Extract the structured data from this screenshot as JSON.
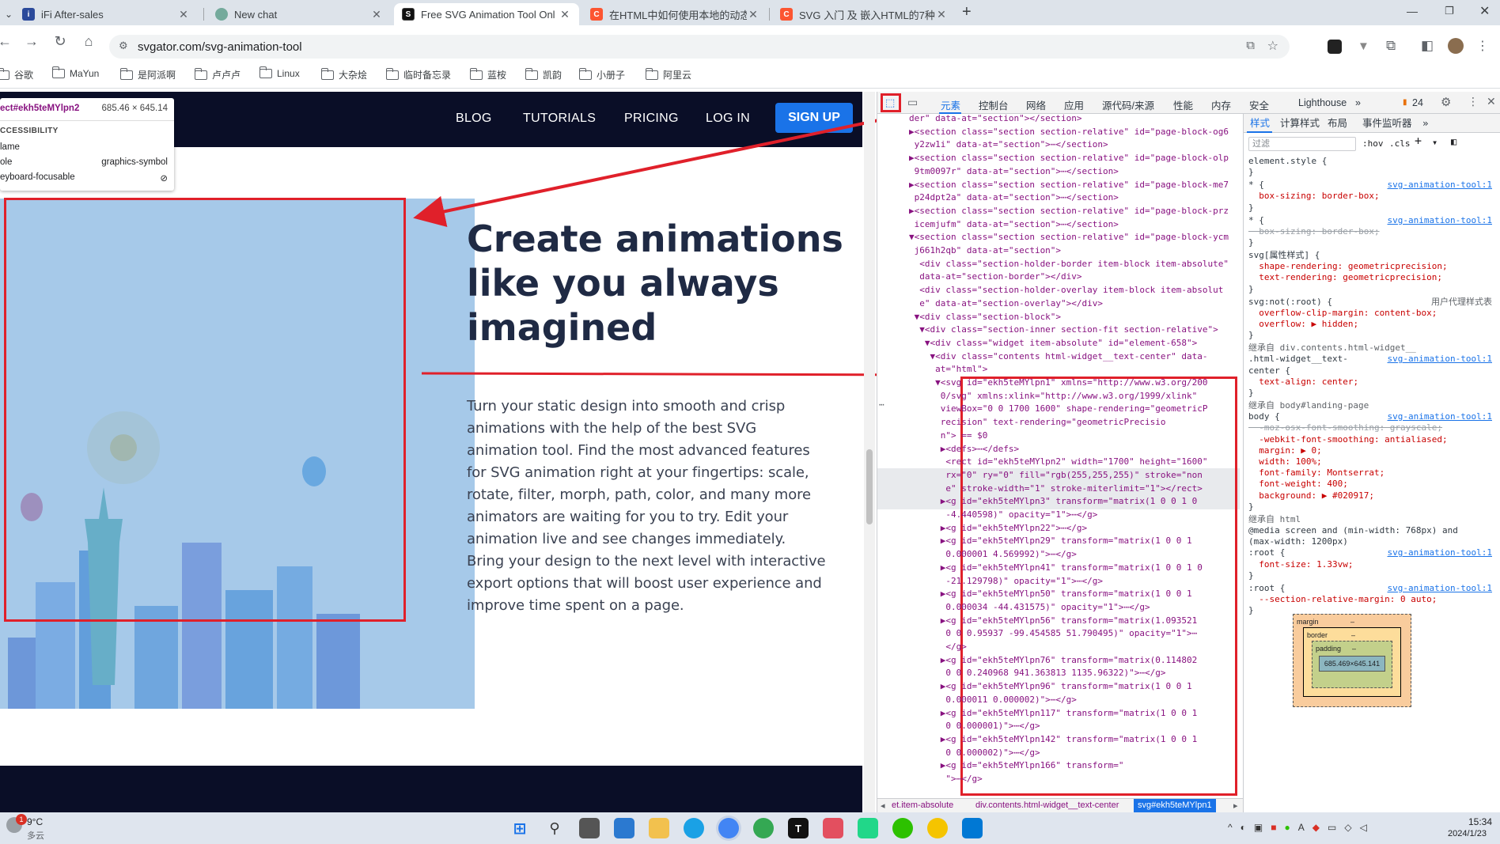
{
  "tabs": [
    {
      "title": "iFi After-sales",
      "icon": "ifi-favicon",
      "active": false
    },
    {
      "title": "New chat",
      "icon": "chatgpt-favicon",
      "active": false
    },
    {
      "title": "Free SVG Animation Tool Onl",
      "icon": "svgator-favicon",
      "active": true
    },
    {
      "title": "在HTML中如何使用本地的动态",
      "icon": "csdn-favicon",
      "active": false
    },
    {
      "title": "SVG 入门 及 嵌入HTML的7种方",
      "icon": "csdn-favicon",
      "active": false
    }
  ],
  "omnibox": {
    "url": "svgator.com/svg-animation-tool"
  },
  "bookmarks": [
    "谷歌",
    "MaYun",
    "是阿派啊",
    "卢卢卢",
    "Linux",
    "大杂烩",
    "临时备忘录",
    "蓝桉",
    "凯韵",
    "小册子",
    "阿里云"
  ],
  "site": {
    "nav": [
      "BLOG",
      "TUTORIALS",
      "PRICING",
      "LOG IN"
    ],
    "signup": "SIGN UP",
    "hero_title_lines": [
      "Create animations",
      "like you always",
      "imagined"
    ],
    "hero_body_lines": [
      "Turn your static design into smooth and crisp",
      "animations with the help of the best SVG",
      "animation tool. Find the most advanced features",
      "for SVG animation right at your fingertips: scale,",
      "rotate, filter, morph, path, color, and many more",
      "animators are waiting for you to try. Edit your",
      "animation live and see changes immediately.",
      "Bring your design to the next level with interactive",
      "export options that will boost user experience and",
      "improve time spent on a page."
    ]
  },
  "tooltip": {
    "element": "ect#ekh5teMYlpn2",
    "size": "685.46 × 645.14",
    "section": "CCESSIBILITY",
    "name_label": "lame",
    "role_label": "ole",
    "role_value": "graphics-symbol",
    "focus_label": "eyboard-focusable"
  },
  "devtools": {
    "tabs": [
      "元素",
      "控制台",
      "网络",
      "应用",
      "源代码/来源",
      "性能",
      "内存",
      "安全",
      "Lighthouse"
    ],
    "issues_count": "24",
    "style_tabs": [
      "样式",
      "计算样式",
      "布局",
      "事件监听器"
    ],
    "filter_placeholder": "过滤",
    "hov": ":hov",
    "cls": ".cls",
    "dom_lines": [
      "der\" data-at=\"section\"></section>",
      "▶<section class=\"section section-relative\" id=\"page-block-og6",
      " y2zw1i\" data-at=\"section\">⋯</section>",
      "▶<section class=\"section section-relative\" id=\"page-block-olp",
      " 9tm0097r\" data-at=\"section\">⋯</section>",
      "▶<section class=\"section section-relative\" id=\"page-block-me7",
      " p24dpt2a\" data-at=\"section\">⋯</section>",
      "▶<section class=\"section section-relative\" id=\"page-block-prz",
      " icemjufm\" data-at=\"section\">⋯</section>",
      "▼<section class=\"section section-relative\" id=\"page-block-ycm",
      " j661h2qb\" data-at=\"section\">",
      "  <div class=\"section-holder-border item-block item-absolute\"",
      "  data-at=\"section-border\"></div>",
      "  <div class=\"section-holder-overlay item-block item-absolut",
      "  e\" data-at=\"section-overlay\"></div>",
      " ▼<div class=\"section-block\">",
      "  ▼<div class=\"section-inner section-fit section-relative\">",
      "   ▼<div class=\"widget item-absolute\" id=\"element-658\">",
      "    ▼<div class=\"contents html-widget__text-center\" data-",
      "     at=\"html\">",
      "     ▼<svg id=\"ekh5teMYlpn1\" xmlns=\"http://www.w3.org/200",
      "      0/svg\" xmlns:xlink=\"http://www.w3.org/1999/xlink\"",
      "      viewBox=\"0 0 1700 1600\" shape-rendering=\"geometricP",
      "      recision\" text-rendering=\"geometricPrecisio",
      "      n\"> == $0",
      "      ▶<defs>⋯</defs>",
      "       <rect id=\"ekh5teMYlpn2\" width=\"1700\" height=\"1600\"",
      "       rx=\"0\" ry=\"0\" fill=\"rgb(255,255,255)\" stroke=\"non",
      "       e\" stroke-width=\"1\" stroke-miterlimit=\"1\"></rect>",
      "      ▶<g id=\"ekh5teMYlpn3\" transform=\"matrix(1 0 0 1 0",
      "       -4.440598)\" opacity=\"1\">⋯</g>",
      "      ▶<g id=\"ekh5teMYlpn22\">⋯</g>",
      "      ▶<g id=\"ekh5teMYlpn29\" transform=\"matrix(1 0 0 1",
      "       0.000001 4.569992)\">⋯</g>",
      "      ▶<g id=\"ekh5teMYlpn41\" transform=\"matrix(1 0 0 1 0",
      "       -21.129798)\" opacity=\"1\">⋯</g>",
      "      ▶<g id=\"ekh5teMYlpn50\" transform=\"matrix(1 0 0 1",
      "       0.000034 -44.431575)\" opacity=\"1\">⋯</g>",
      "      ▶<g id=\"ekh5teMYlpn56\" transform=\"matrix(1.093521",
      "       0 0 0.95937 -99.454585 51.790495)\" opacity=\"1\">⋯",
      "       </g>",
      "      ▶<g id=\"ekh5teMYlpn76\" transform=\"matrix(0.114802",
      "       0 0 0.240968 941.363813 1135.96322)\">⋯</g>",
      "      ▶<g id=\"ekh5teMYlpn96\" transform=\"matrix(1 0 0 1",
      "       0.000011 0.000002)\">⋯</g>",
      "      ▶<g id=\"ekh5teMYlpn117\" transform=\"matrix(1 0 0 1",
      "       0 0.000001)\">⋯</g>",
      "      ▶<g id=\"ekh5teMYlpn142\" transform=\"matrix(1 0 0 1",
      "       0 0.000002)\">⋯</g>",
      "      ▶<g id=\"ekh5teMYlpn166\" transform=\"",
      "       \">⋯</g>"
    ],
    "breadcrumbs": [
      "et.item-absolute",
      "div.contents.html-widget__text-center",
      "svg#ekh5teMYlpn1"
    ],
    "style_lines": [
      {
        "t": "element.style {",
        "src": ""
      },
      {
        "t": "}",
        "src": ""
      },
      {
        "t": "* {",
        "src": "svg-animation-tool:1"
      },
      {
        "t": "  box-sizing: border-box;",
        "src": ""
      },
      {
        "t": "}",
        "src": ""
      },
      {
        "t": "* {",
        "src": "svg-animation-tool:1"
      },
      {
        "t": "  box-sizing: border-box;",
        "src": "",
        "strike": true
      },
      {
        "t": "}",
        "src": ""
      },
      {
        "t": "svg[属性样式] {",
        "src": ""
      },
      {
        "t": "  shape-rendering: geometricprecision;",
        "src": ""
      },
      {
        "t": "  text-rendering: geometricprecision;",
        "src": ""
      },
      {
        "t": "}",
        "src": ""
      },
      {
        "t": "svg:not(:root) {",
        "src": "用户代理样式表"
      },
      {
        "t": "  overflow-clip-margin: content-box;",
        "src": ""
      },
      {
        "t": "  overflow: ▶ hidden;",
        "src": ""
      },
      {
        "t": "}",
        "src": ""
      },
      {
        "t": "继承自 div.contents.html-widget__",
        "src": ""
      },
      {
        "t": ".html-widget__text-",
        "src": "svg-animation-tool:1"
      },
      {
        "t": "center {",
        "src": ""
      },
      {
        "t": "  text-align: center;",
        "src": ""
      },
      {
        "t": "}",
        "src": ""
      },
      {
        "t": "继承自 body#landing-page",
        "src": ""
      },
      {
        "t": "body {",
        "src": "svg-animation-tool:1"
      },
      {
        "t": "  -moz-osx-font-smoothing: grayscale;",
        "src": "",
        "strike": true
      },
      {
        "t": "  -webkit-font-smoothing: antialiased;",
        "src": ""
      },
      {
        "t": "  margin: ▶ 0;",
        "src": ""
      },
      {
        "t": "  width: 100%;",
        "src": ""
      },
      {
        "t": "  font-family: Montserrat;",
        "src": ""
      },
      {
        "t": "  font-weight: 400;",
        "src": ""
      },
      {
        "t": "  background: ▶ #020917;",
        "src": ""
      },
      {
        "t": "}",
        "src": ""
      },
      {
        "t": "继承自 html",
        "src": ""
      },
      {
        "t": "@media screen and (min-width: 768px) and",
        "src": ""
      },
      {
        "t": "(max-width: 1200px)",
        "src": ""
      },
      {
        "t": ":root {",
        "src": "svg-animation-tool:1"
      },
      {
        "t": "  font-size: 1.33vw;",
        "src": ""
      },
      {
        "t": "}",
        "src": ""
      },
      {
        "t": ":root {",
        "src": "svg-animation-tool:1"
      },
      {
        "t": "  --section-relative-margin: 0 auto;",
        "src": ""
      },
      {
        "t": "}",
        "src": ""
      }
    ],
    "boxmodel": {
      "margin": "margin",
      "border": "border",
      "padding": "padding",
      "content": "685.469×645.141",
      "dash": "–"
    }
  },
  "taskbar": {
    "weather_temp": "9°C",
    "weather_desc": "多云",
    "time": "15:34",
    "date": "2024/1/23",
    "notif_badge": "1"
  },
  "colors": {
    "nav_bg": "#0a0e27",
    "signup": "#1a73e8",
    "highlight": "#6fa8dc",
    "annotation_red": "#e0202a"
  }
}
